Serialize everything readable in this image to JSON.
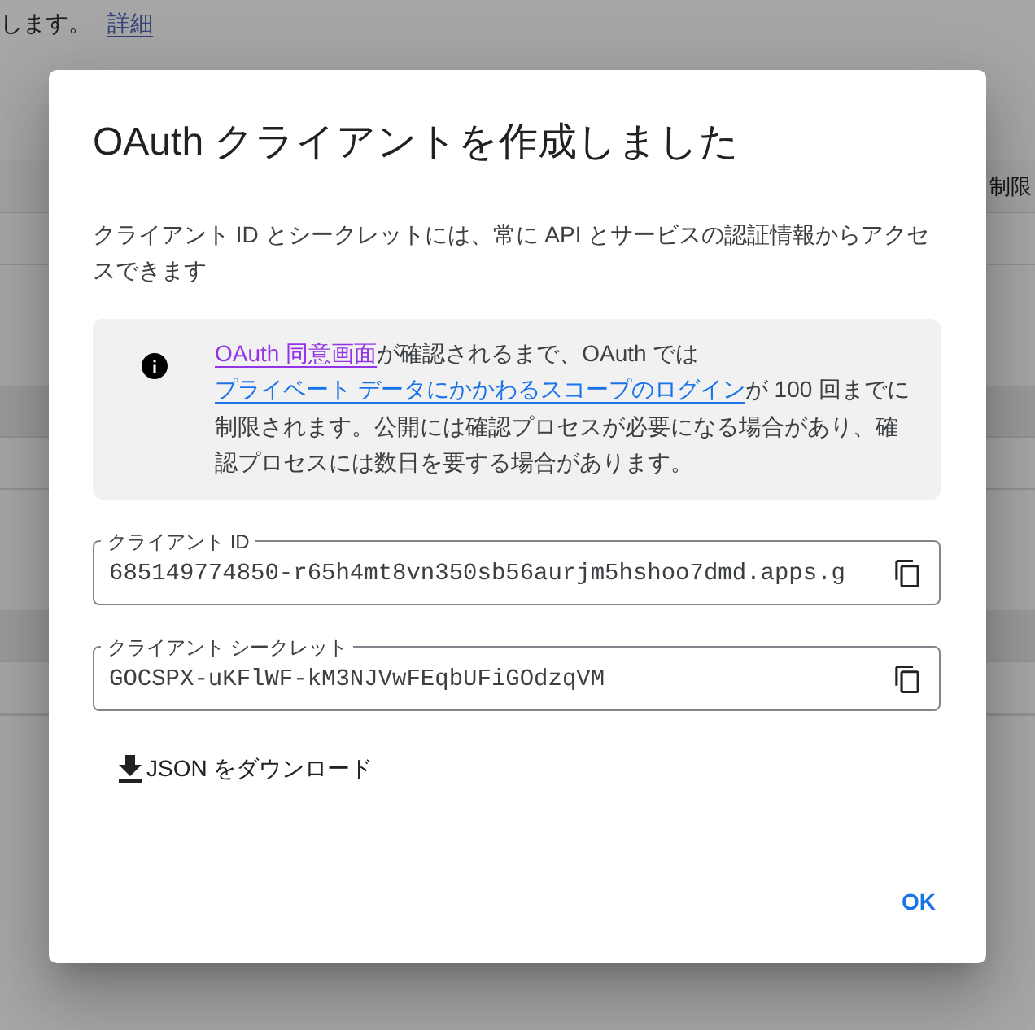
{
  "background_page": {
    "intro_text": "します。",
    "details_link": "詳細",
    "table": {
      "header_cell": "制限"
    }
  },
  "dialog": {
    "title": "OAuth クライアントを作成しました",
    "description": "クライアント ID とシークレットには、常に API とサービスの認証情報からアクセスできます",
    "notice": {
      "parts": [
        {
          "kind": "link",
          "text": "OAuth 同意画面",
          "visited": true
        },
        {
          "kind": "text",
          "text": "が確認されるまで、OAuth では"
        },
        {
          "kind": "link",
          "text": "プライベート データにかかわるスコープのログイン",
          "visited": false
        },
        {
          "kind": "text",
          "text": "が 100 回までに制限されます。公開には確認プロセスが必要になる場合があり、確認プロセスには数日を要する場合があります。"
        }
      ]
    },
    "fields": [
      {
        "label": "クライアント ID",
        "value": "685149774850-r65h4mt8vn350sb56aurjm5hshoo7dmd.apps.g"
      },
      {
        "label": "クライアント シークレット",
        "value": "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"
      }
    ],
    "download_button": "JSON をダウンロード",
    "ok_button": "OK"
  }
}
